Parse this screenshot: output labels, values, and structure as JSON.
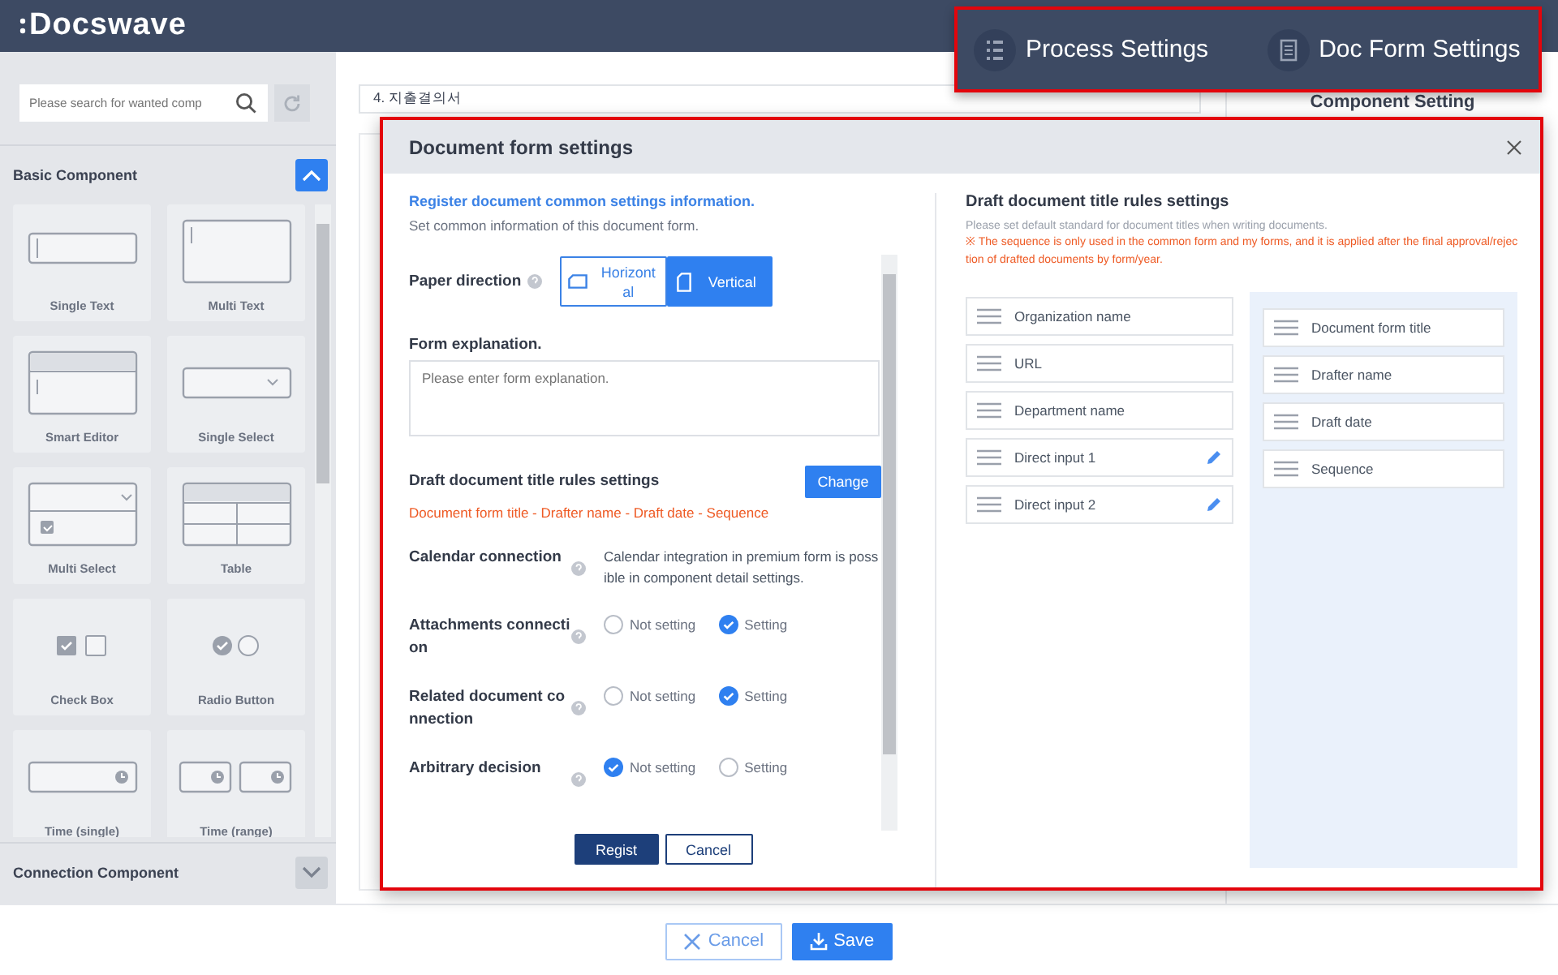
{
  "header": {
    "logo": "Docswave"
  },
  "nav_popup": {
    "items": [
      {
        "label": "Process Settings",
        "kind": "list"
      },
      {
        "label": "Doc Form Settings",
        "kind": "document"
      }
    ]
  },
  "sidebar": {
    "search": {
      "placeholder": "Please search for wanted comp"
    },
    "sections": [
      {
        "title": "Basic Component",
        "expanded": true,
        "components": [
          {
            "label": "Single Text",
            "kind": "single_text"
          },
          {
            "label": "Multi Text",
            "kind": "multi_text"
          },
          {
            "label": "Smart Editor",
            "kind": "smart_editor"
          },
          {
            "label": "Single Select",
            "kind": "single_select"
          },
          {
            "label": "Multi Select",
            "kind": "multi_select"
          },
          {
            "label": "Table",
            "kind": "table"
          },
          {
            "label": "Check Box",
            "kind": "check_box"
          },
          {
            "label": "Radio Button",
            "kind": "radio_button"
          },
          {
            "label": "Time (single)",
            "kind": "time_single"
          },
          {
            "label": "Time (range)",
            "kind": "time_range"
          }
        ]
      },
      {
        "title": "Connection Component",
        "expanded": false
      }
    ]
  },
  "document": {
    "title_value": "4. 지출결의서",
    "side_panel_title": "Component Setting"
  },
  "modal": {
    "title": "Document form settings",
    "intro_heading": "Register document common settings information.",
    "intro_text": "Set common information of this document form.",
    "paper_direction": {
      "label": "Paper direction",
      "options": [
        {
          "label": "Horizontal",
          "kind": "horizontal",
          "selected": false
        },
        {
          "label": "Vertical",
          "kind": "vertical",
          "selected": true
        }
      ]
    },
    "form_explanation": {
      "label": "Form explanation.",
      "placeholder": "Please enter form explanation."
    },
    "title_rules": {
      "label": "Draft document title rules settings",
      "button": "Change",
      "value": "Document form title - Drafter name - Draft date - Sequence"
    },
    "calendar": {
      "label": "Calendar connection",
      "note": "Calendar integration in premium form is possible in component detail settings."
    },
    "radio_settings": [
      {
        "label": "Attachments connection",
        "options": [
          {
            "label": "Not setting",
            "selected": false
          },
          {
            "label": "Setting",
            "selected": true
          }
        ]
      },
      {
        "label": "Related document connection",
        "options": [
          {
            "label": "Not setting",
            "selected": false
          },
          {
            "label": "Setting",
            "selected": true
          }
        ]
      },
      {
        "label": "Arbitrary decision",
        "options": [
          {
            "label": "Not setting",
            "selected": true
          },
          {
            "label": "Setting",
            "selected": false
          }
        ]
      }
    ],
    "buttons": [
      {
        "label": "Regist",
        "kind": "primary"
      },
      {
        "label": "Cancel",
        "kind": "secondary"
      }
    ],
    "rules_panel": {
      "title": "Draft document title rules settings",
      "description": "Please set default standard for document titles when writing documents.",
      "note": "※ The sequence is only used in the common form and my forms, and it is applied after the final approval/rejection of drafted documents by form/year.",
      "available": [
        {
          "label": "Organization name",
          "editable": false
        },
        {
          "label": "URL",
          "editable": false
        },
        {
          "label": "Department name",
          "editable": false
        },
        {
          "label": "Direct input 1",
          "editable": true
        },
        {
          "label": "Direct input 2",
          "editable": true
        }
      ],
      "selected": [
        {
          "label": "Document form title"
        },
        {
          "label": "Drafter name"
        },
        {
          "label": "Draft date"
        },
        {
          "label": "Sequence"
        }
      ]
    }
  },
  "footer": {
    "buttons": [
      {
        "label": "Cancel",
        "kind": "cancel"
      },
      {
        "label": "Save",
        "kind": "save"
      }
    ]
  }
}
